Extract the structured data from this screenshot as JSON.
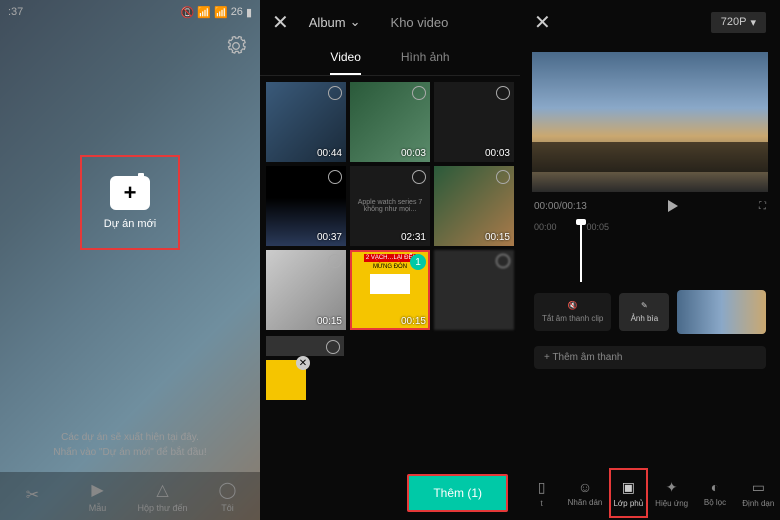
{
  "panel1": {
    "status_time": ":37",
    "status_battery": "26",
    "new_project": "Dự án mới",
    "empty_line1": "Các dự án sẽ xuất hiện tại đây.",
    "empty_line2": "Nhấn vào \"Dự án mới\" để bắt đầu!",
    "nav": {
      "edit": "",
      "template": "Mẫu",
      "inbox": "Hộp thư đến",
      "me": "Tôi"
    }
  },
  "panel2": {
    "album": "Album",
    "kho_video": "Kho video",
    "tab_video": "Video",
    "tab_image": "Hình ảnh",
    "durations": [
      "00:44",
      "00:03",
      "00:03",
      "00:37",
      "02:31",
      "00:15",
      "00:15",
      "00:15",
      ""
    ],
    "yellow_title": "2 VẠCH…LẠI ĐỂ!",
    "yellow_sub": "MỪNG ĐÓN",
    "apple_text": "Apple watch series 7 không như mọi...",
    "selected_badge": "1",
    "add_button": "Thêm (1)"
  },
  "panel3": {
    "resolution": "720P",
    "time_current": "00:00",
    "time_total": "00:13",
    "ruler": [
      "00:00",
      "00:05"
    ],
    "mute_label": "Tắt âm thanh clip",
    "cover_label": "Ảnh bìa",
    "add_audio": "+ Thêm âm thanh",
    "toolbar": {
      "cut": "t",
      "label": "Nhãn dán",
      "overlay": "Lớp phủ",
      "effect": "Hiệu ứng",
      "filter": "Bộ lọc",
      "format": "Định dạn"
    }
  }
}
